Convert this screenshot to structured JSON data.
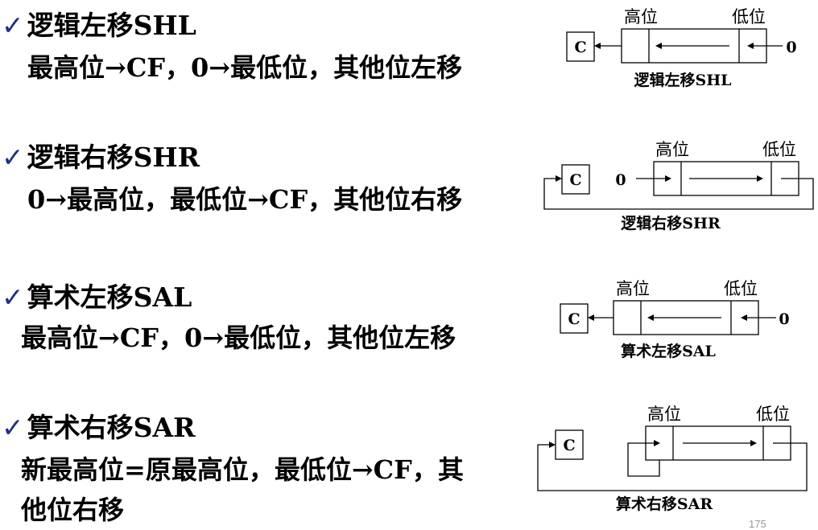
{
  "check": "✓",
  "sections": [
    {
      "title": "逻辑左移SHL",
      "desc": "最高位→CF，0→最低位，其他位左移",
      "diagram": {
        "carry": "C",
        "high": "高位",
        "low": "低位",
        "input": "0",
        "caption": "逻辑左移SHL"
      }
    },
    {
      "title": "逻辑右移SHR",
      "desc": "0→最高位，最低位→CF，其他位右移",
      "diagram": {
        "carry": "C",
        "high": "高位",
        "low": "低位",
        "input": "0",
        "caption": "逻辑右移SHR"
      }
    },
    {
      "title": "算术左移SAL",
      "desc": "最高位→CF，0→最低位，其他位左移",
      "diagram": {
        "carry": "C",
        "high": "高位",
        "low": "低位",
        "input": "0",
        "caption": "算术左移SAL"
      }
    },
    {
      "title": "算术右移SAR",
      "desc_line1": "新最高位=原最高位，最低位→CF，其",
      "desc_line2": "他位右移",
      "diagram": {
        "carry": "C",
        "high": "高位",
        "low": "低位",
        "caption": "算术右移SAR"
      }
    }
  ],
  "page_number": "175"
}
